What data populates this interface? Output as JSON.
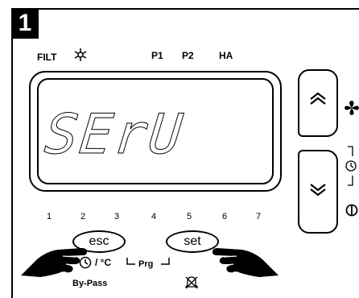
{
  "step": {
    "number": "1"
  },
  "top_indicators": {
    "filt": "FILT",
    "p1": "P1",
    "p2": "P2",
    "ha": "HA"
  },
  "display": {
    "text": "SErU"
  },
  "digit_positions": [
    "1",
    "2",
    "3",
    "4",
    "5",
    "6",
    "7"
  ],
  "buttons": {
    "esc": "esc",
    "set": "set"
  },
  "bottom_labels": {
    "clock_unit": "/ °C",
    "prg": "Prg",
    "bypass": "By-Pass"
  },
  "icons": {
    "snowflake": "snowflake-icon",
    "fan": "fan-icon",
    "clock": "clock-icon",
    "power": "power-icon",
    "alarm_muted": "alarm-muted-icon",
    "hand_left": "hand-icon",
    "hand_right": "hand-icon"
  }
}
